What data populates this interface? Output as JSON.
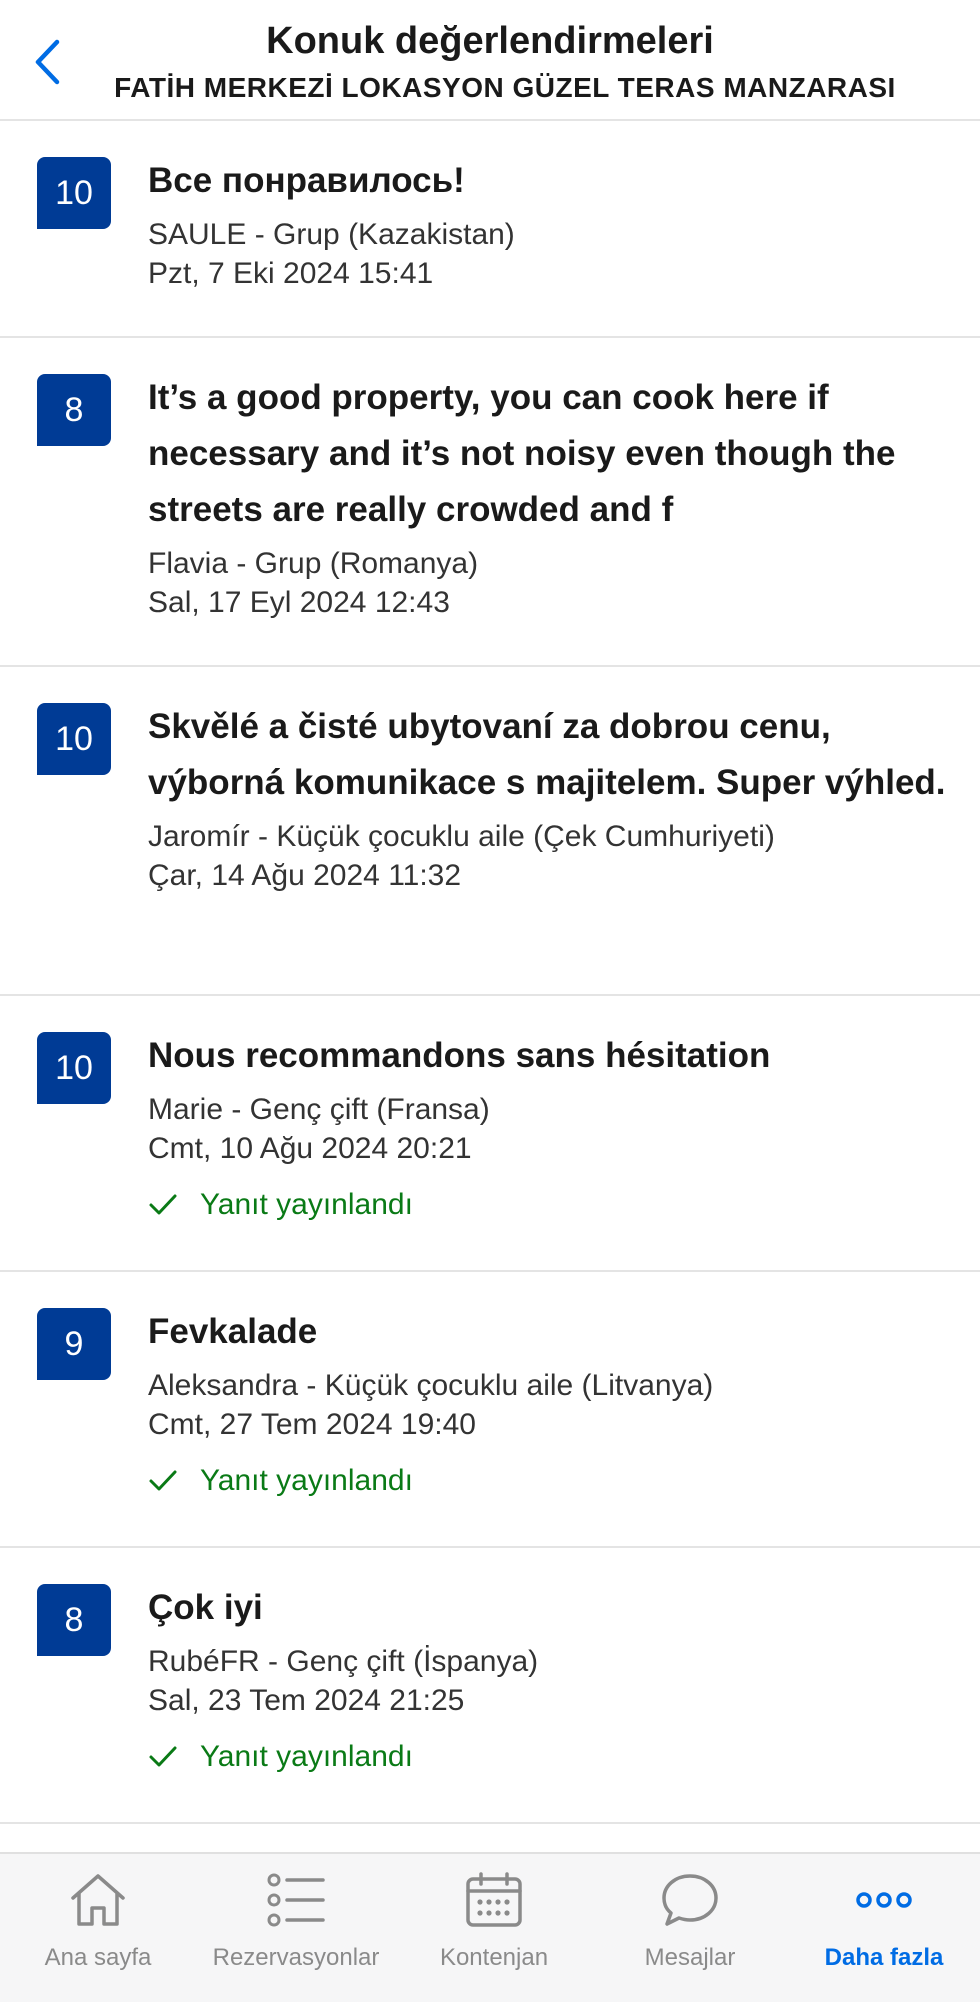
{
  "header": {
    "title": "Konuk değerlendirmeleri",
    "subtitle": "FATİH MERKEZİ LOKASYON GÜZEL TERAS MANZARASI"
  },
  "reviews": [
    {
      "score": "10",
      "title": "Все понравилось!",
      "guest": "SAULE - Grup (Kazakistan)",
      "date": "Pzt, 7 Eki 2024 15:41",
      "reply": ""
    },
    {
      "score": "8",
      "title": "It’s a good property, you can cook here if necessary and it’s not noisy even though the streets are really crowded and f",
      "guest": "Flavia - Grup (Romanya)",
      "date": "Sal, 17 Eyl 2024 12:43",
      "reply": ""
    },
    {
      "score": "10",
      "title": "Skvělé a čisté ubytovaní za dobrou cenu, výborná komunikace s majitelem. Super výhled.",
      "guest": "Jaromír - Küçük çocuklu aile (Çek Cumhuriyeti)",
      "date": "Çar, 14 Ağu 2024 11:32",
      "reply": ""
    },
    {
      "score": "10",
      "title": "Nous recommandons sans hésitation",
      "guest": "Marie - Genç çift (Fransa)",
      "date": "Cmt, 10 Ağu 2024 20:21",
      "reply": "Yanıt yayınlandı"
    },
    {
      "score": "9",
      "title": "Fevkalade",
      "guest": "Aleksandra - Küçük çocuklu aile (Litvanya)",
      "date": "Cmt, 27 Tem 2024 19:40",
      "reply": "Yanıt yayınlandı"
    },
    {
      "score": "8",
      "title": "Çok iyi",
      "guest": "RubéFR - Genç çift (İspanya)",
      "date": "Sal, 23 Tem 2024 21:25",
      "reply": "Yanıt yayınlandı"
    }
  ],
  "tabbar": {
    "items": [
      {
        "label": "Ana sayfa",
        "icon": "home-icon"
      },
      {
        "label": "Rezervasyonlar",
        "icon": "list-icon"
      },
      {
        "label": "Kontenjan",
        "icon": "calendar-icon"
      },
      {
        "label": "Mesajlar",
        "icon": "chat-bubble-icon"
      },
      {
        "label": "Daha fazla",
        "icon": "more-dots-icon"
      }
    ],
    "active": "Daha fazla"
  },
  "colors": {
    "score_bg": "#003b95",
    "reply_green": "#0a7a16",
    "accent_blue": "#006ce4"
  }
}
